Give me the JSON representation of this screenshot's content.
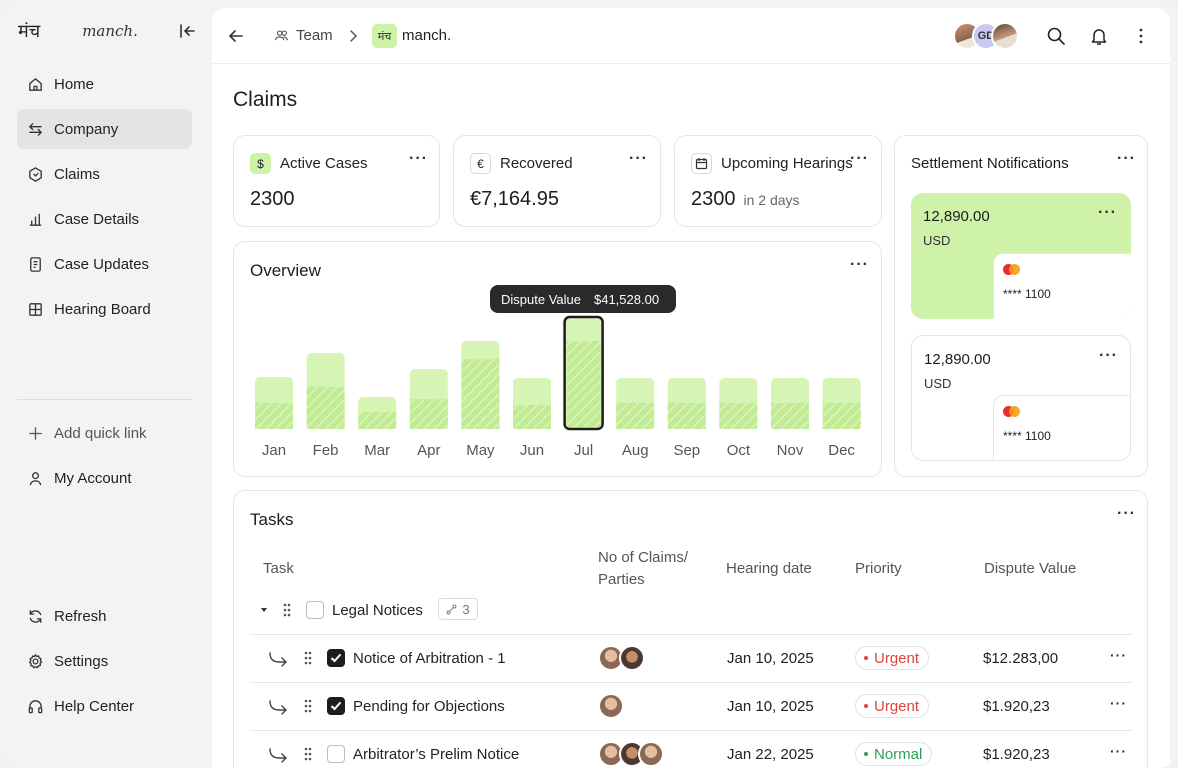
{
  "sidebar": {
    "logo_mark": "मंच",
    "logo_word": "manch.",
    "nav": [
      {
        "label": "Home",
        "icon": "home-icon"
      },
      {
        "label": "Company",
        "icon": "arrows-swap-icon",
        "active": true
      },
      {
        "label": "Claims",
        "icon": "claims-icon"
      },
      {
        "label": "Case Details",
        "icon": "bar-chart-icon"
      },
      {
        "label": "Case Updates",
        "icon": "document-icon"
      },
      {
        "label": "Hearing Board",
        "icon": "grid-icon"
      }
    ],
    "quick": [
      {
        "label": "Add quick link",
        "icon": "plus-icon"
      },
      {
        "label": "My Account",
        "icon": "user-icon"
      }
    ],
    "footer": [
      {
        "label": "Refresh",
        "icon": "refresh-icon"
      },
      {
        "label": "Settings",
        "icon": "gear-icon"
      },
      {
        "label": "Help Center",
        "icon": "headphones-icon"
      }
    ]
  },
  "topbar": {
    "crumb_team": "Team",
    "crumb_chip": "मंच",
    "crumb_company": "manch.",
    "avatar_initials": "GD"
  },
  "page": {
    "title": "Claims"
  },
  "stats": [
    {
      "label": "Active Cases",
      "value": "2300",
      "icon": "dollar-icon",
      "glyph": "$",
      "sub": ""
    },
    {
      "label": "Recovered",
      "value": "€7,164.95",
      "icon": "euro-icon",
      "glyph": "€",
      "sub": ""
    },
    {
      "label": "Upcoming Hearings",
      "value": "2300",
      "icon": "calendar-icon",
      "glyph": "",
      "sub": "in 2 days"
    }
  ],
  "overview": {
    "title": "Overview",
    "tooltip_label": "Dispute Value",
    "tooltip_value": "$41,528.00"
  },
  "chart_data": {
    "type": "bar",
    "title": "Overview",
    "categories": [
      "Jan",
      "Feb",
      "Mar",
      "Apr",
      "May",
      "Jun",
      "Jul",
      "Aug",
      "Sep",
      "Oct",
      "Nov",
      "Dec"
    ],
    "values": [
      52,
      76,
      32,
      60,
      88,
      51,
      112,
      51,
      51,
      51,
      51,
      51
    ],
    "inner_values": [
      26,
      42,
      17,
      30,
      70,
      24,
      88,
      26,
      26,
      26,
      26,
      26
    ],
    "highlight": "Jul",
    "colors": {
      "bar": "#d6f5b4",
      "inner": "#c2eb94",
      "highlight_border": "#1d1d1d"
    }
  },
  "settlements": {
    "title": "Settlement Notifications",
    "items": [
      {
        "amount": "12,890.00",
        "currency": "USD",
        "card": "**** 1100",
        "style": "green"
      },
      {
        "amount": "12,890.00",
        "currency": "USD",
        "card": "**** 1100",
        "style": "white"
      }
    ]
  },
  "tasks": {
    "title": "Tasks",
    "headers": {
      "task": "Task",
      "claims": "No of Claims/ Parties",
      "date": "Hearing date",
      "priority": "Priority",
      "value": "Dispute Value"
    },
    "group": {
      "name": "Legal Notices",
      "count": "3"
    },
    "rows": [
      {
        "name": "Notice of Arbitration - 1",
        "checked": true,
        "date": "Jan 10, 2025",
        "priority": "Urgent",
        "value": "$12.283,00"
      },
      {
        "name": "Pending for Objections",
        "checked": true,
        "date": "Jan 10, 2025",
        "priority": "Urgent",
        "value": "$1.920,23"
      },
      {
        "name": "Arbitrator’s Prelim Notice",
        "checked": false,
        "date": "Jan 22, 2025",
        "priority": "Normal",
        "value": "$1.920,23"
      }
    ],
    "priority_colors": {
      "Urgent": "#e0433a",
      "Normal": "#2f9e55"
    }
  }
}
